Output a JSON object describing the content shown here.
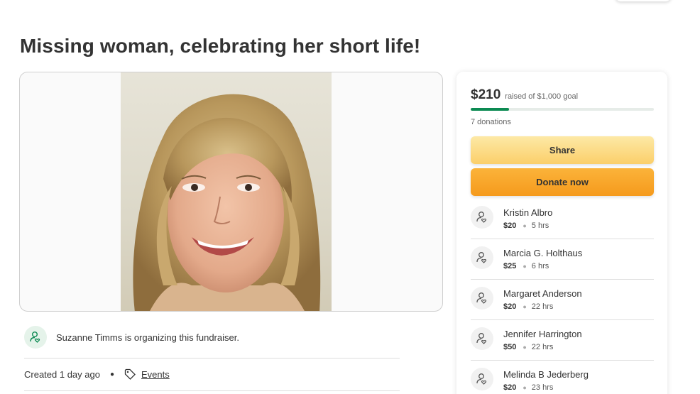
{
  "title": "Missing woman, celebrating her short life!",
  "organizer": {
    "text": "Suzanne Timms is organizing this fundraiser.",
    "icon": "user-heart-icon"
  },
  "meta": {
    "created": "Created 1 day ago",
    "category": "Events"
  },
  "summary": {
    "raised": "$210",
    "goal_text": "raised of $1,000 goal",
    "progress_fraction": 0.21,
    "donations": "7 donations",
    "progress_color": "#0c8a52"
  },
  "buttons": {
    "share": "Share",
    "donate": "Donate now"
  },
  "donors": [
    {
      "name": "Kristin Albro",
      "amount": "$20",
      "time": "5 hrs"
    },
    {
      "name": "Marcia G. Holthaus",
      "amount": "$25",
      "time": "6 hrs"
    },
    {
      "name": "Margaret Anderson",
      "amount": "$20",
      "time": "22 hrs"
    },
    {
      "name": "Jennifer Harrington",
      "amount": "$50",
      "time": "22 hrs"
    },
    {
      "name": "Melinda B Jederberg",
      "amount": "$20",
      "time": "23 hrs"
    }
  ]
}
